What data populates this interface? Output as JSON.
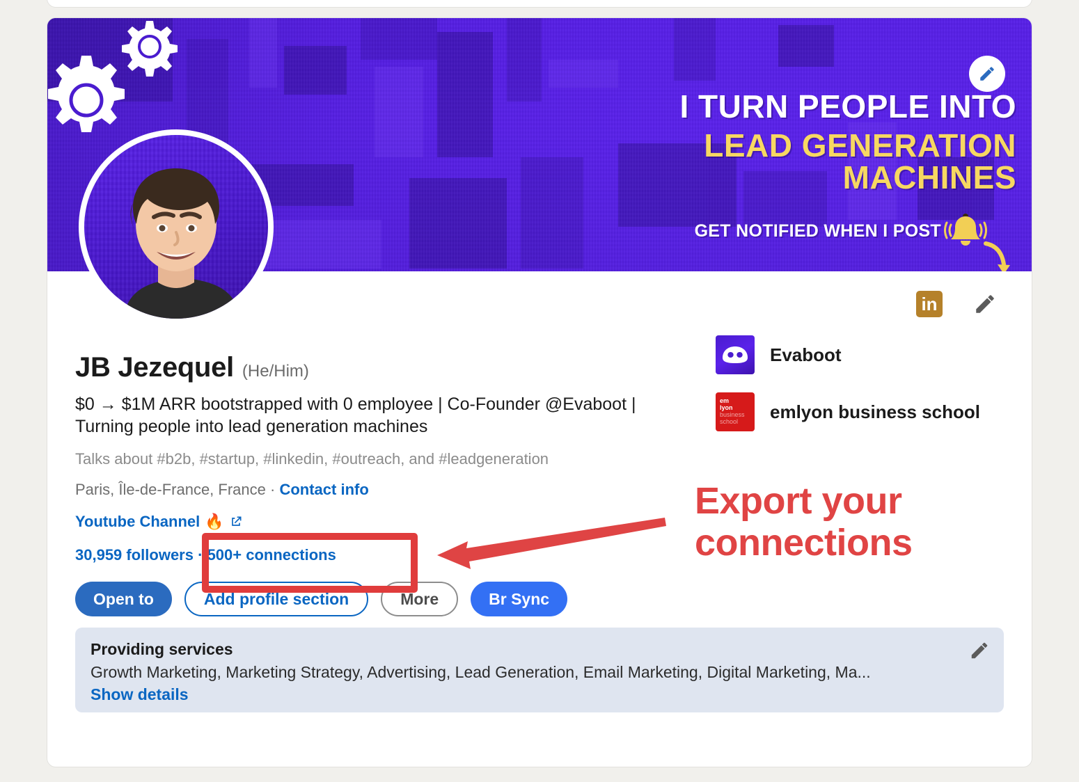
{
  "banner": {
    "headline_line1": "I TURN PEOPLE INTO",
    "headline_line2": "LEAD GENERATION MACHINES",
    "subtext": "GET NOTIFIED WHEN I POST",
    "edit_icon": "pencil-icon",
    "gears_icon": "gears-icon",
    "bell_icon": "bell-icon",
    "curved_arrow_icon": "curved-arrow-icon",
    "background_color": "#5a22ea",
    "accent_color": "#f7d862"
  },
  "profile": {
    "name": "JB Jezequel",
    "pronouns": "(He/Him)",
    "headline": "$0 → $1M ARR bootstrapped with 0 employee | Co-Founder @Evaboot | Turning people into lead generation machines",
    "talks_about": "Talks about #b2b, #startup, #linkedin, #outreach, and #leadgeneration",
    "location": "Paris, Île-de-France, France",
    "location_separator": "·",
    "contact_info": "Contact info",
    "website_label": "Youtube Channel",
    "website_emoji": "🔥",
    "external_link_icon": "external-link-icon",
    "followers": "30,959 followers",
    "counts_separator": "·",
    "connections": "500+ connections",
    "avatar_icon": "profile-photo"
  },
  "actions": [
    {
      "label": "Open to",
      "style": "primary",
      "name": "open-to-button"
    },
    {
      "label": "Add profile section",
      "style": "outline-blue",
      "name": "add-profile-section-button"
    },
    {
      "label": "More",
      "style": "outline-grey",
      "name": "more-button"
    },
    {
      "label": "Br  Sync",
      "style": "sync",
      "name": "br-sync-button"
    }
  ],
  "services": {
    "title": "Providing services",
    "list": "Growth Marketing, Marketing Strategy, Advertising, Lead Generation, Email Marketing, Digital Marketing, Ma...",
    "show_details": "Show details",
    "edit_icon": "pencil-icon",
    "background_color": "#dfe5f0"
  },
  "right_column": {
    "linkedin_badge": "in",
    "linkedin_badge_color": "#b5812a",
    "edit_icon": "pencil-icon",
    "organizations": [
      {
        "name": "Evaboot",
        "logo": "evaboot-logo"
      },
      {
        "name": "emlyon business school",
        "logo": "emlyon-logo"
      }
    ],
    "emlyon_logo_lines": [
      "em",
      "lyon",
      "business",
      "school"
    ]
  },
  "annotation": {
    "text_line1": "Export your",
    "text_line2": "connections",
    "color": "#e04444",
    "highlight_target": "500+ connections",
    "arrow_icon": "left-arrow-annotation"
  }
}
